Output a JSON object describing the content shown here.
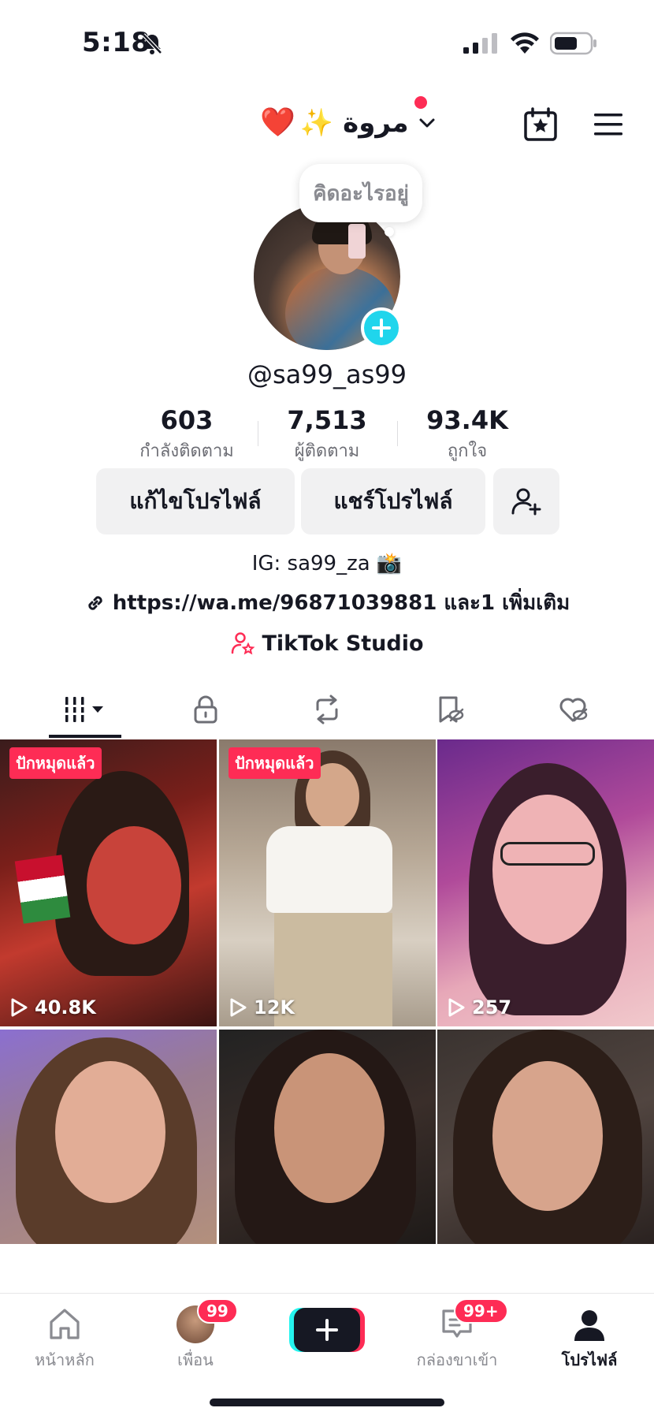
{
  "status_bar": {
    "time": "5:18"
  },
  "header": {
    "name_emoji_heart": "❤️",
    "name_emoji_sparkles": "✨",
    "display_name": "مروة"
  },
  "thought_bubble": {
    "text": "คิดอะไรอยู่"
  },
  "profile": {
    "handle": "@sa99_as99"
  },
  "stats": [
    {
      "value": "603",
      "label": "กำลังติดตาม"
    },
    {
      "value": "7,513",
      "label": "ผู้ติดตาม"
    },
    {
      "value": "93.4K",
      "label": "ถูกใจ"
    }
  ],
  "buttons": {
    "edit_profile": "แก้ไขโปรไฟล์",
    "share_profile": "แชร์โปรไฟล์"
  },
  "bio": {
    "ig_line": "IG: sa99_za 📸",
    "link": "https://wa.me/96871039881 และ1 เพิ่มเติม",
    "studio": "TikTok Studio"
  },
  "tabs": [
    "videos-grid",
    "private",
    "reposts",
    "favorites",
    "liked"
  ],
  "videos": [
    {
      "pinned_label": "ปักหมุดแล้ว",
      "views": "40.8K"
    },
    {
      "pinned_label": "ปักหมุดแล้ว",
      "views": "12K"
    },
    {
      "pinned_label": "",
      "views": "257"
    },
    {
      "pinned_label": "",
      "views": ""
    },
    {
      "pinned_label": "",
      "views": ""
    },
    {
      "pinned_label": "",
      "views": ""
    }
  ],
  "bottom_nav": {
    "home": "หน้าหลัก",
    "friends": "เพื่อน",
    "friends_badge": "99",
    "inbox": "กล่องขาเข้า",
    "inbox_badge": "99+",
    "profile": "โปรไฟล์"
  },
  "colors": {
    "accent_red": "#fe2c55",
    "accent_cyan": "#25f4ee",
    "plus_blue": "#20d5ec",
    "text": "#161823"
  }
}
